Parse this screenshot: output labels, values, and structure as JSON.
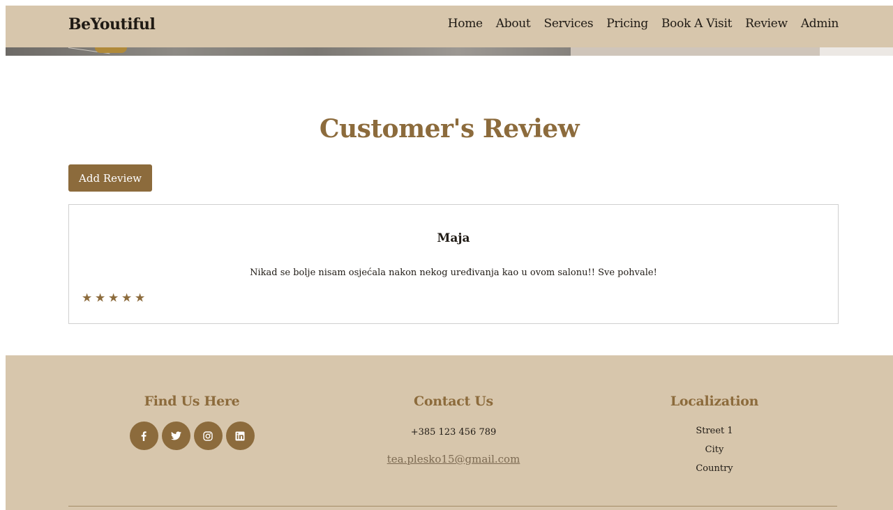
{
  "navbar": {
    "brand": "BeYoutiful",
    "links": [
      "Home",
      "About",
      "Services",
      "Pricing",
      "Book A Visit",
      "Review",
      "Admin"
    ]
  },
  "reviews_section": {
    "title": "Customer's Review",
    "add_button_label": "Add Review",
    "reviews": [
      {
        "name": "Maja",
        "text": "Nikad se bolje nisam osjećala nakon nekog uređivanja kao u ovom salonu!! Sve pohvale!",
        "rating": 5,
        "star_glyph": "★"
      }
    ]
  },
  "footer": {
    "find_us": {
      "heading": "Find Us Here",
      "socials": [
        "facebook-icon",
        "twitter-icon",
        "instagram-icon",
        "linkedin-icon"
      ]
    },
    "contact": {
      "heading": "Contact Us",
      "phone": "+385 123 456 789",
      "email": "tea.plesko15@gmail.com"
    },
    "localization": {
      "heading": "Localization",
      "street": "Street 1",
      "city": "City",
      "country": "Country"
    }
  },
  "colors": {
    "accent": "#8c6b3c",
    "nav_bg": "#d7c6ac",
    "footer_bg": "#d7c6ac"
  }
}
